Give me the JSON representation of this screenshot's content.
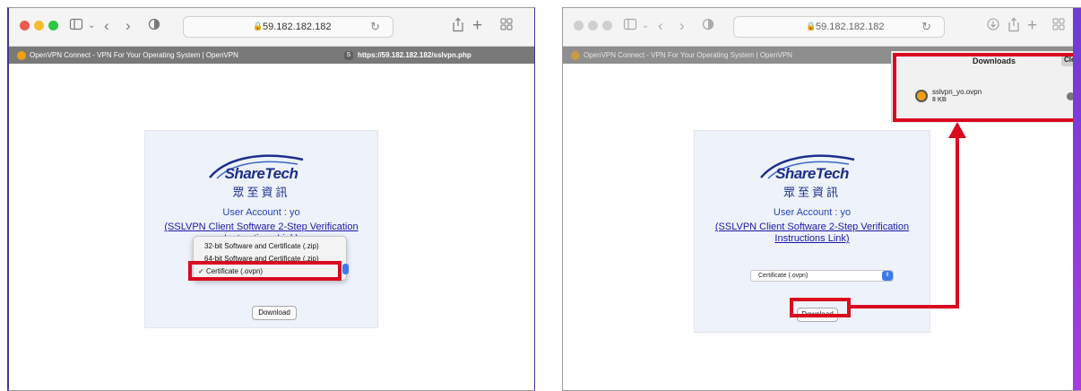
{
  "colors": {
    "accent_red": "#d9091e",
    "brand_blue": "#1c2f8c",
    "link_blue": "#1a1aa8",
    "traffic_red": "#ee5a50",
    "traffic_yellow": "#f3bd2f",
    "traffic_green": "#2dc840",
    "select_blue": "#3d79e8"
  },
  "left_window": {
    "url": "59.182.182.182",
    "tabs": [
      {
        "title": "OpenVPN Connect - VPN For Your Operating System | OpenVPN"
      },
      {
        "title": "https://59.182.182.182/sslvpn.php",
        "badge": "S"
      }
    ],
    "brand": "ShareTech",
    "brand_cn": "眾至資訊",
    "account_text": "User Account : yo",
    "link_line1": "(SSLVPN Client Software 2-Step Verification",
    "link_line2": "Instructions Link)",
    "dropdown_options": [
      {
        "label": "32-bit Software and Certificate (.zip)",
        "checked": false
      },
      {
        "label": "64-bit Software and Certificate (.zip)",
        "checked": false
      },
      {
        "label": "Certificate (.ovpn)",
        "checked": true
      }
    ],
    "checkmark": "✓",
    "download_label": "Download"
  },
  "right_window": {
    "url": "59.182.182.182",
    "tabs": [
      {
        "title": "OpenVPN Connect - VPN For Your Operating System | OpenVPN"
      }
    ],
    "downloads_title": "Downloads",
    "clear_label": "Clea",
    "file_name": "sslvpn_yo.ovpn",
    "file_size": "8 KB",
    "brand": "ShareTech",
    "brand_cn": "眾至資訊",
    "account_text": "User Account : yo",
    "link_line1": "(SSLVPN Client Software 2-Step Verification",
    "link_line2": "Instructions Link)",
    "select_value": "Certificate (.ovpn)",
    "download_label": "Download"
  },
  "icons": {
    "sidebar": "sidebar-icon",
    "chevron": "chevron-down-icon",
    "back": "back-icon",
    "forward": "forward-icon",
    "shield": "privacy-shield-icon",
    "lock": "lock-icon",
    "reload": "reload-icon",
    "share": "share-icon",
    "new_tab": "plus-icon",
    "tabs_overview": "tab-overview-icon",
    "downloads": "downloads-icon",
    "magnifier": "magnifier-icon"
  }
}
